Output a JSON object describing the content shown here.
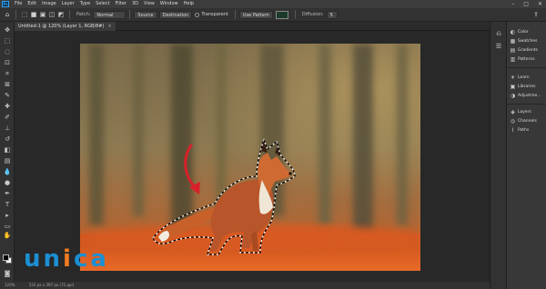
{
  "menubar": {
    "logo": "Ps",
    "items": [
      "File",
      "Edit",
      "Image",
      "Layer",
      "Type",
      "Select",
      "Filter",
      "3D",
      "View",
      "Window",
      "Help"
    ],
    "window_controls": [
      "–",
      "□",
      "✕"
    ]
  },
  "options_bar": {
    "patch_label": "Patch:",
    "patch_value": "Normal",
    "source_label": "Source",
    "destination_label": "Destination",
    "transparent_label": "Transparent",
    "use_pattern_label": "Use Pattern",
    "diffusion_label": "Diffusion:",
    "diffusion_value": "5"
  },
  "document": {
    "tab_title": "Untitled-1 @ 120% (Layer 1, RGB/8#)",
    "close_glyph": "×"
  },
  "status": {
    "zoom": "120%",
    "info": "533 px x 397 px (72 ppi)"
  },
  "panels": {
    "group1": [
      {
        "icon": "◐",
        "label": "Color"
      },
      {
        "icon": "▦",
        "label": "Swatches"
      },
      {
        "icon": "▤",
        "label": "Gradients"
      },
      {
        "icon": "▥",
        "label": "Patterns"
      }
    ],
    "group2": [
      {
        "icon": "☀",
        "label": "Learn"
      },
      {
        "icon": "▣",
        "label": "Libraries"
      },
      {
        "icon": "◑",
        "label": "Adjustme..."
      }
    ],
    "group3": [
      {
        "icon": "◈",
        "label": "Layers"
      },
      {
        "icon": "◎",
        "label": "Channels"
      },
      {
        "icon": "⌇",
        "label": "Paths"
      }
    ]
  },
  "watermark": {
    "part1": "un",
    "part2": "i",
    "part3": "ca"
  },
  "colors": {
    "accent": "#2fa3f7",
    "arrow": "#d8202a"
  }
}
